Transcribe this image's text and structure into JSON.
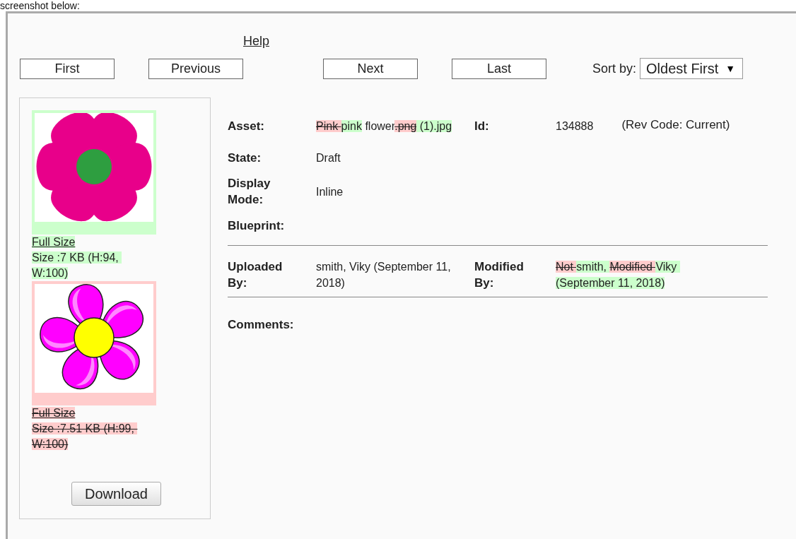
{
  "caption": "screenshot below:",
  "help_link": "Help",
  "nav_buttons": [
    "First",
    "Previous",
    "Next",
    "Last"
  ],
  "sort": {
    "label": "Sort by:",
    "value": "Oldest First",
    "arrow": "▼"
  },
  "versions": [
    {
      "kind": "added",
      "link": "Full Size",
      "size": "Size :7 KB (H:94, W:100)"
    },
    {
      "kind": "removed",
      "link": "Full Size",
      "size": "Size :7.51 KB (H:99, W:100)"
    }
  ],
  "download_button": "Download",
  "sections": [
    {
      "rows": [
        [
          {
            "label": "Asset:",
            "segments": [
              {
                "text": "Pink ",
                "kind": "removed"
              },
              {
                "text": "pink",
                "kind": "added"
              },
              {
                "text": " flower",
                "kind": "same"
              },
              {
                "text": ".png",
                "kind": "removed"
              },
              {
                "text": " (1).jpg",
                "kind": "added"
              }
            ]
          },
          {
            "label": "Id:",
            "segments": [
              {
                "text": "134888",
                "kind": "same"
              }
            ],
            "note": "(Rev Code: Current)"
          }
        ],
        [
          {
            "label": "State:",
            "segments": [
              {
                "text": "Draft",
                "kind": "same"
              }
            ]
          }
        ],
        [
          {
            "label": "Display Mode:",
            "segments": [
              {
                "text": "Inline",
                "kind": "same"
              }
            ]
          }
        ],
        [
          {
            "label": "Blueprint:"
          }
        ]
      ]
    },
    {
      "rows": [
        [
          {
            "label": "Uploaded By:",
            "segments": [
              {
                "text": "smith, Viky (September 11, 2018)",
                "kind": "same"
              }
            ]
          },
          {
            "label": "Modified By:",
            "segments": [
              {
                "text": "Not ",
                "kind": "removed"
              },
              {
                "text": "smith, ",
                "kind": "added"
              },
              {
                "text": "Modified ",
                "kind": "removed"
              },
              {
                "text": "Viky (September 11, 2018)",
                "kind": "added"
              }
            ]
          }
        ]
      ]
    },
    {
      "rows": [
        [
          {
            "label": "Comments:"
          }
        ]
      ]
    }
  ]
}
